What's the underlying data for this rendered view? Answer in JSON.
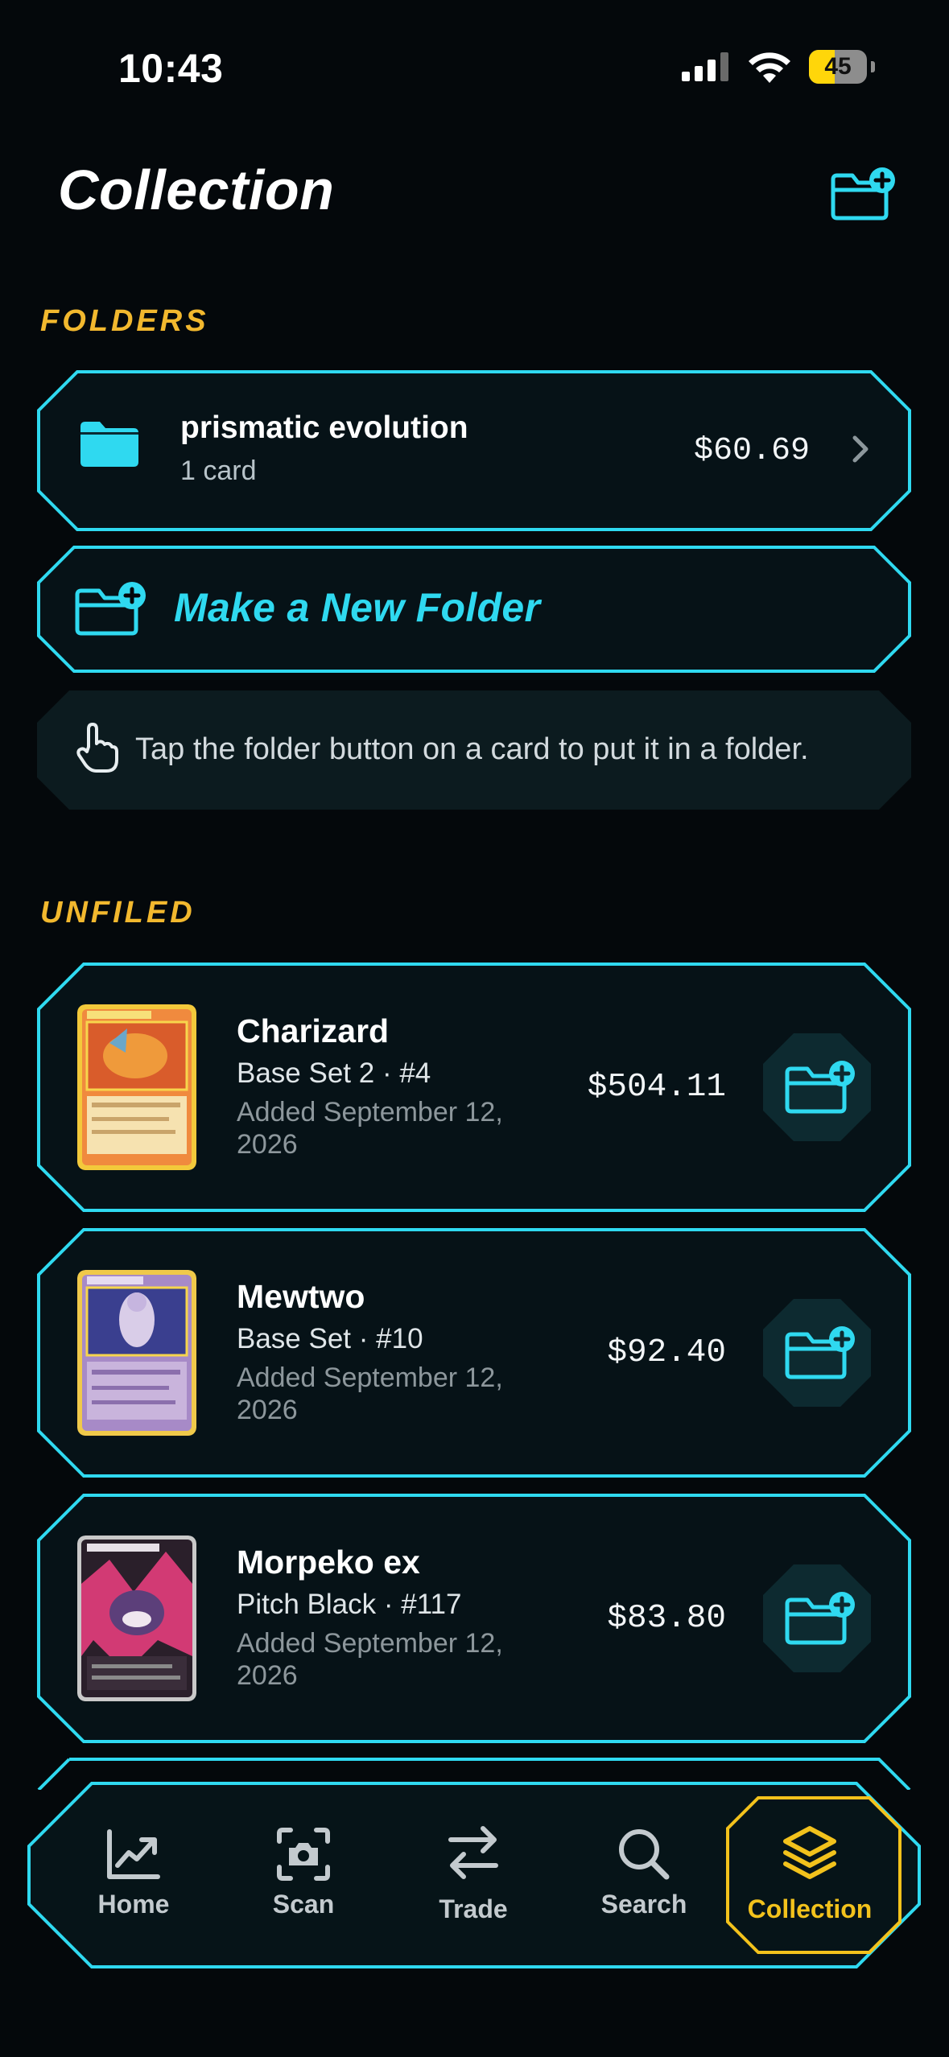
{
  "status_bar": {
    "time": "10:43",
    "battery": "45",
    "battery_level": 0.45
  },
  "header": {
    "title": "Collection",
    "add_folder_icon": "folder-plus-icon"
  },
  "folders_section": {
    "label": "FOLDERS",
    "folders": [
      {
        "name": "prismatic evolution",
        "count": "1 card",
        "value": "$60.69"
      }
    ],
    "new_folder_label": "Make a New Folder",
    "hint": "Tap the folder button on a card to put it in a folder."
  },
  "unfiled_section": {
    "label": "UNFILED",
    "cards": [
      {
        "name": "Charizard",
        "set": "Base Set 2 · #4",
        "added": "Added September 12, 2026",
        "price": "$504.11"
      },
      {
        "name": "Mewtwo",
        "set": "Base Set · #10",
        "added": "Added September 12, 2026",
        "price": "$92.40"
      },
      {
        "name": "Morpeko ex",
        "set": "Pitch Black · #117",
        "added": "Added September 12, 2026",
        "price": "$83.80"
      }
    ]
  },
  "nav": {
    "items": [
      {
        "label": "Home",
        "icon": "chart-line-icon"
      },
      {
        "label": "Scan",
        "icon": "camera-scan-icon"
      },
      {
        "label": "Trade",
        "icon": "arrows-exchange-icon"
      },
      {
        "label": "Search",
        "icon": "search-icon"
      },
      {
        "label": "Collection",
        "icon": "layers-icon",
        "active": true
      }
    ]
  },
  "colors": {
    "accent": "#2fd9f0",
    "gold": "#f2b82e",
    "background": "#04080b",
    "panel": "#061217"
  }
}
